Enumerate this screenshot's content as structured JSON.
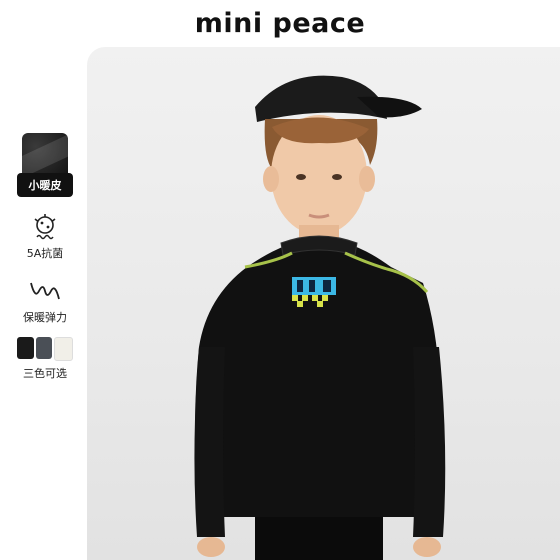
{
  "brand": "mini peace",
  "side_panel": {
    "material_label": "小暖皮",
    "features": [
      {
        "icon": "antibacterial-icon",
        "label": "5A抗菌"
      },
      {
        "icon": "warm-stretch-icon",
        "label": "保暖弹力"
      }
    ],
    "color_options_label": "三色可选",
    "color_swatches": [
      "#1a1a1a",
      "#4a4f56",
      "#f1efe8"
    ]
  },
  "colors": {
    "shirt": "#111111",
    "accent": "#a7c24a"
  }
}
